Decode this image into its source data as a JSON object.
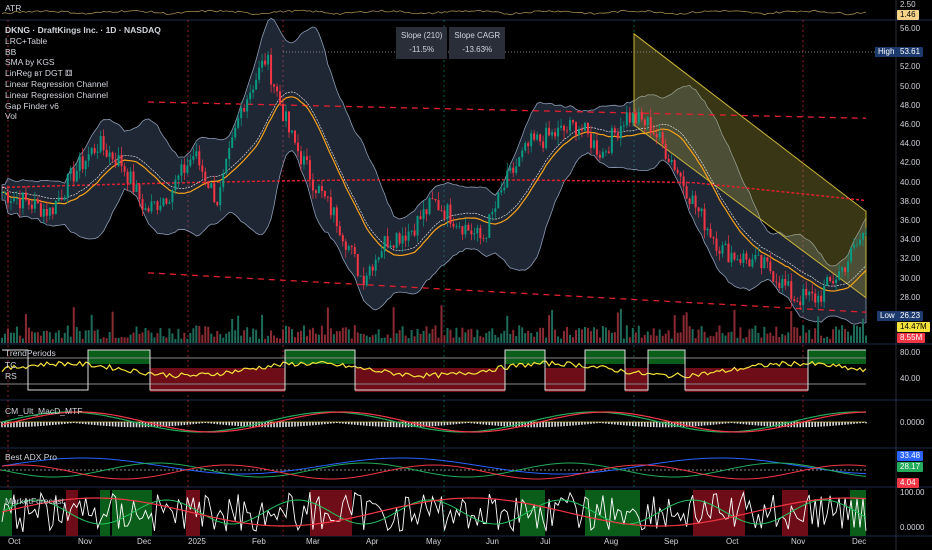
{
  "symbol_title": "DKNG · DraftKings Inc. · 1D · NASDAQ",
  "indicators": [
    "LRC+Table",
    "BB",
    "SMA by KGS",
    "LinReg вт DGT ⚅",
    "Linear Regression Channel",
    "Linear Regression Channel",
    "Gap Finder v6",
    "Vol"
  ],
  "panes": {
    "atr": "ATR",
    "trend": "TrendPeriods",
    "trend_sub1": "TC",
    "trend_sub2": "RS",
    "macd": "CM_Ult_MacD_MTF",
    "adx": "Best ADX Pro",
    "mf": "MarketForecast"
  },
  "table": {
    "h1": "Slope (210)",
    "h2": "Slope CAGR",
    "v1": "-11.5%",
    "v2": "-13.63%"
  },
  "price_axis": [
    "56.00",
    "52.00",
    "50.00",
    "48.00",
    "46.00",
    "44.00",
    "42.00",
    "40.00",
    "38.00",
    "36.00",
    "34.00",
    "32.00",
    "30.00",
    "28.00"
  ],
  "atr_axis": {
    "top": "2.50",
    "current": "1.46"
  },
  "high": {
    "label": "High",
    "value": "53.61"
  },
  "low": {
    "label": "Low",
    "value": "26.23"
  },
  "vol_tags": {
    "a": "14.47M",
    "b": "8.55M"
  },
  "trend_axis": [
    "80.00",
    "40.00"
  ],
  "macd_axis": "0.0000",
  "adx_tags": {
    "blue": "33.48",
    "green": "28.17",
    "red": "4.04"
  },
  "mf_axis": [
    "100.00",
    "0.0000"
  ],
  "time_axis": [
    "Oct",
    "Nov",
    "Dec",
    "2025",
    "Feb",
    "Mar",
    "Apr",
    "May",
    "Jun",
    "Jul",
    "Aug",
    "Sep",
    "Oct",
    "Nov",
    "Dec"
  ],
  "colors": {
    "up": "#089981",
    "down": "#f23645",
    "bb": "#8c9bb5",
    "sma": "#f7a21b",
    "lr": "#e0202e",
    "channel": "#c9b53a"
  },
  "chart_data": {
    "type": "candlestick",
    "price_path": [
      39,
      38,
      37,
      41,
      44,
      42,
      37,
      39,
      43,
      38,
      48,
      53,
      45,
      40,
      36,
      30,
      34,
      35,
      38,
      36,
      34,
      40,
      44,
      45,
      46,
      43,
      47,
      46,
      42,
      37,
      33,
      32,
      31,
      28,
      28,
      31,
      35
    ],
    "ylim": [
      26,
      57
    ]
  }
}
